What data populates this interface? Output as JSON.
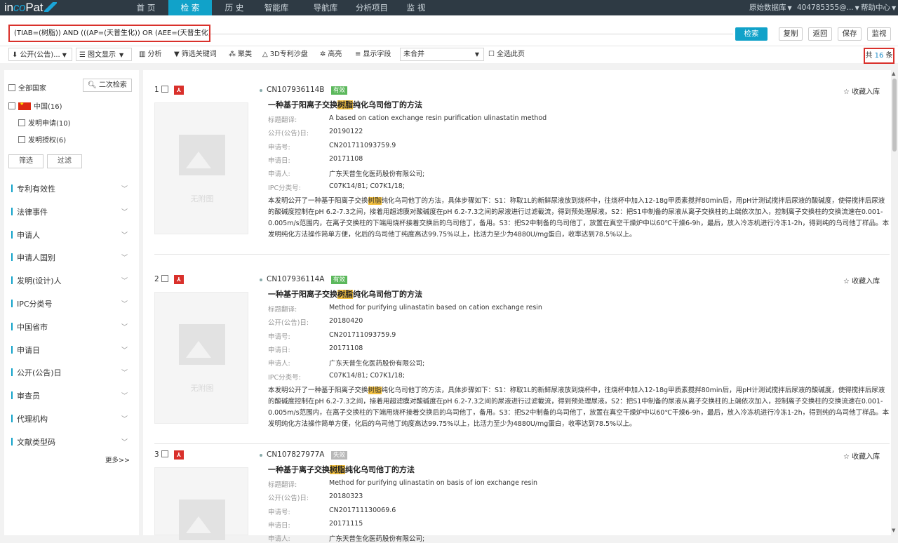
{
  "brand": {
    "logo_a": "in",
    "logo_b": "co",
    "logo_c": "Pat"
  },
  "nav": [
    "首 页",
    "检 索",
    "历 史",
    "智能库",
    "导航库",
    "分析项目",
    "监 视"
  ],
  "nav_active_index": 1,
  "top_right": {
    "db": "原始数据库",
    "user": "404785355@...",
    "help": "帮助中心"
  },
  "search": {
    "query": "(TIAB=(树脂)) AND (((AP=(天普生化)) OR (AEE=(天普生化))))",
    "search_label": "检索",
    "buttons": [
      "复制",
      "返回",
      "保存",
      "监视"
    ]
  },
  "toolbar": {
    "pub": "公开(公告)...",
    "view": "图文显示",
    "analyze": "分析",
    "filter_kw": "筛选关键词",
    "cluster": "聚类",
    "sandbox": "3D专利沙盘",
    "highlight": "高亮",
    "fields": "显示字段",
    "merge": "未合并",
    "select_page": "全选此页",
    "total_prefix": "共",
    "total_num": "16",
    "total_suffix": "条"
  },
  "sidebar": {
    "all_countries": "全部国家",
    "second_search": "二次检索",
    "china": "中国(16)",
    "invention_app": "发明申请(10)",
    "invention_grant": "发明授权(6)",
    "btn_filter": "筛选",
    "btn_exclude": "过滤",
    "facets": [
      "专利有效性",
      "法律事件",
      "申请人",
      "申请人国别",
      "发明(设计)人",
      "IPC分类号",
      "中国省市",
      "申请日",
      "公开(公告)日",
      "审查员",
      "代理机构",
      "文献类型码"
    ],
    "more": "更多>>"
  },
  "labels": {
    "title_trans": "标题翻译:",
    "pub_date": "公开(公告)日:",
    "app_no": "申请号:",
    "app_date": "申请日:",
    "applicant": "申请人:",
    "ipc": "IPC分类号:",
    "fav": "收藏入库",
    "no_image": "无附图"
  },
  "records": [
    {
      "num": "1",
      "pn": "CN107936114B",
      "status": "有效",
      "title_a": "一种基于阳离子交换",
      "title_hl": "树脂",
      "title_b": "纯化乌司他丁的方法",
      "title_trans": "A based on cation exchange resin purification ulinastatin method",
      "pub_date": "20190122",
      "app_no": "CN201711093759.9",
      "app_date": "20171108",
      "applicant": "广东天普生化医药股份有限公司;",
      "ipc": "C07K14/81; C07K1/18;",
      "abs_a": "本发明公开了一种基于阳离子交换",
      "abs_hl": "树脂",
      "abs_b": "纯化乌司他丁的方法，具体步骤如下：S1：称取1L的新鲜尿液放到烧杯中，往烧杯中加入12-18g甲质素搅拌80min后，用pH计测试搅拌后尿液的酸碱度，使得搅拌后尿液的酸碱度控制在pH 6.2-7.3之间，接着用超滤膜对酸碱度在pH 6.2-7.3之间的尿液进行过滤截流，得到预处理尿液。S2：把S1中制备的尿液从离子交换柱的上端依次加入，控制离子交换柱的交换流速在0.001-0.005m/s范围内，在离子交换柱的下端用烧杯接着交换后的乌司他丁，备用。S3：把S2中制备的乌司他丁，放置在真空干燥炉中以60℃干燥6-9h，最后，放入冷冻机进行冷冻1-2h，得到纯的乌司他丁样品。本发明纯化方法操作简单方便，化后的乌司他丁纯度高达99.75%以上，比活力至少为4880U/mg蛋白，收率达到78.5%以上。"
    },
    {
      "num": "2",
      "pn": "CN107936114A",
      "status": "有效",
      "title_a": "一种基于阳离子交换",
      "title_hl": "树脂",
      "title_b": "纯化乌司他丁的方法",
      "title_trans": "Method for purifying ulinastatin based on cation exchange resin",
      "pub_date": "20180420",
      "app_no": "CN201711093759.9",
      "app_date": "20171108",
      "applicant": "广东天普生化医药股份有限公司;",
      "ipc": "C07K14/81; C07K1/18;",
      "abs_a": "本发明公开了一种基于阳离子交换",
      "abs_hl": "树脂",
      "abs_b": "纯化乌司他丁的方法，具体步骤如下：S1：称取1L的新鲜尿液放到烧杯中，往烧杯中加入12-18g甲质素搅拌80min后，用pH计测试搅拌后尿液的酸碱度，使得搅拌后尿液的酸碱度控制在pH 6.2-7.3之间，接着用超滤膜对酸碱度在pH 6.2-7.3之间的尿液进行过滤截流，得到预处理尿液。S2：把S1中制备的尿液从离子交换柱的上端依次加入，控制离子交换柱的交换流速在0.001-0.005m/s范围内，在离子交换柱的下端用烧杯接着交换后的乌司他丁，备用。S3：把S2中制备的乌司他丁，放置在真空干燥炉中以60℃干燥6-9h，最后，放入冷冻机进行冷冻1-2h，得到纯的乌司他丁样品。本发明纯化方法操作简单方便，化后的乌司他丁纯度高达99.75%以上，比活力至少为4880U/mg蛋白，收率达到78.5%以上。"
    },
    {
      "num": "3",
      "pn": "CN107827977A",
      "status": "失效",
      "title_a": "一种基于离子交换",
      "title_hl": "树脂",
      "title_b": "纯化乌司他丁的方法",
      "title_trans": "Method for purifying ulinastatin on basis of ion exchange resin",
      "pub_date": "20180323",
      "app_no": "CN201711130069.6",
      "app_date": "20171115",
      "applicant": "广东天普生化医药股份有限公司;"
    }
  ],
  "colors": {
    "accent": "#11a2c9",
    "topbar": "#2e3a44",
    "highlight_box": "#d9302b",
    "valid": "#5cb85c",
    "invalid": "#b8b8b8",
    "term_highlight": "#f6c342"
  }
}
